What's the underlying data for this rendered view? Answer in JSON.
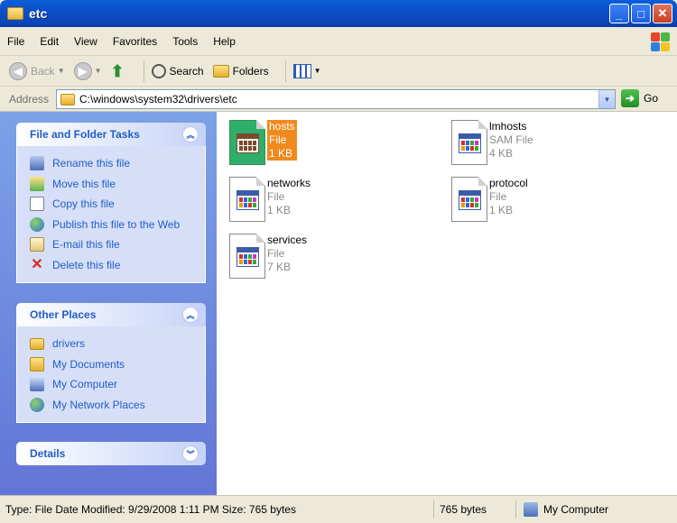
{
  "window": {
    "title": "etc"
  },
  "menu": [
    "File",
    "Edit",
    "View",
    "Favorites",
    "Tools",
    "Help"
  ],
  "toolbar": {
    "back": "Back",
    "search": "Search",
    "folders": "Folders"
  },
  "address": {
    "label": "Address",
    "path": "C:\\windows\\system32\\drivers\\etc",
    "go": "Go"
  },
  "tasks_panel": {
    "title": "File and Folder Tasks",
    "items": [
      {
        "label": "Rename this file",
        "icon": "rename-icon"
      },
      {
        "label": "Move this file",
        "icon": "move-icon"
      },
      {
        "label": "Copy this file",
        "icon": "copy-icon"
      },
      {
        "label": "Publish this file to the Web",
        "icon": "globe-icon"
      },
      {
        "label": "E-mail this file",
        "icon": "email-icon"
      },
      {
        "label": "Delete this file",
        "icon": "delete-icon"
      }
    ]
  },
  "places_panel": {
    "title": "Other Places",
    "items": [
      {
        "label": "drivers",
        "icon": "folder-icon"
      },
      {
        "label": "My Documents",
        "icon": "my-documents-icon"
      },
      {
        "label": "My Computer",
        "icon": "my-computer-icon"
      },
      {
        "label": "My Network Places",
        "icon": "network-icon"
      }
    ]
  },
  "details_panel": {
    "title": "Details"
  },
  "files": [
    {
      "name": "hosts",
      "type": "File",
      "size": "1 KB",
      "selected": true
    },
    {
      "name": "lmhosts",
      "type": "SAM File",
      "size": "4 KB",
      "selected": false
    },
    {
      "name": "networks",
      "type": "File",
      "size": "1 KB",
      "selected": false
    },
    {
      "name": "protocol",
      "type": "File",
      "size": "1 KB",
      "selected": false
    },
    {
      "name": "services",
      "type": "File",
      "size": "7 KB",
      "selected": false
    }
  ],
  "status": {
    "main": "Type: File Date Modified: 9/29/2008 1:11 PM Size: 765 bytes",
    "size": "765 bytes",
    "zone": "My Computer"
  }
}
